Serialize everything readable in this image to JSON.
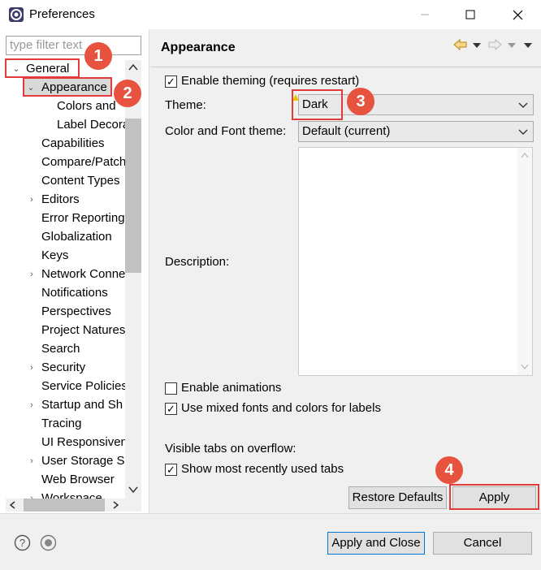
{
  "window": {
    "title": "Preferences",
    "minimize_icon": "minimize-icon",
    "maximize_icon": "maximize-icon",
    "close_icon": "close-icon"
  },
  "filter": {
    "placeholder": "type filter text"
  },
  "tree": {
    "items": [
      {
        "label": "General",
        "arrow": "expanded"
      },
      {
        "label": "Appearance",
        "arrow": "expanded"
      },
      {
        "label": "Colors and",
        "arrow": ""
      },
      {
        "label": "Label Decora",
        "arrow": ""
      },
      {
        "label": "Capabilities",
        "arrow": ""
      },
      {
        "label": "Compare/Patch",
        "arrow": ""
      },
      {
        "label": "Content Types",
        "arrow": ""
      },
      {
        "label": "Editors",
        "arrow": "collapsed"
      },
      {
        "label": "Error Reporting",
        "arrow": ""
      },
      {
        "label": "Globalization",
        "arrow": ""
      },
      {
        "label": "Keys",
        "arrow": ""
      },
      {
        "label": "Network Conne",
        "arrow": "collapsed"
      },
      {
        "label": "Notifications",
        "arrow": ""
      },
      {
        "label": "Perspectives",
        "arrow": ""
      },
      {
        "label": "Project Natures",
        "arrow": ""
      },
      {
        "label": "Search",
        "arrow": ""
      },
      {
        "label": "Security",
        "arrow": "collapsed"
      },
      {
        "label": "Service Policies",
        "arrow": ""
      },
      {
        "label": "Startup and Sh",
        "arrow": "collapsed"
      },
      {
        "label": "Tracing",
        "arrow": ""
      },
      {
        "label": "UI Responsiven",
        "arrow": ""
      },
      {
        "label": "User Storage Se",
        "arrow": "collapsed"
      },
      {
        "label": "Web Browser",
        "arrow": ""
      },
      {
        "label": "Workspace",
        "arrow": "collapsed"
      }
    ]
  },
  "page": {
    "title": "Appearance",
    "enable_theming": {
      "label": "Enable theming (requires restart)",
      "checked": true
    },
    "theme": {
      "label": "Theme:",
      "value": "Dark"
    },
    "color_font_theme": {
      "label": "Color and Font theme:",
      "value": "Default (current)"
    },
    "description_label": "Description:",
    "enable_animations": {
      "label": "Enable animations",
      "checked": false
    },
    "mixed_fonts": {
      "label": "Use mixed fonts and colors for labels",
      "checked": true
    },
    "visible_tabs_label": "Visible tabs on overflow:",
    "show_recent_tabs": {
      "label": "Show most recently used tabs",
      "checked": true
    },
    "restore_defaults": "Restore Defaults",
    "apply": "Apply"
  },
  "footer": {
    "apply_close": "Apply and Close",
    "cancel": "Cancel"
  },
  "annotations": [
    "1",
    "2",
    "3",
    "4"
  ],
  "colors": {
    "annotation_red": "#e8533f",
    "highlight_border": "#e23b3b"
  }
}
